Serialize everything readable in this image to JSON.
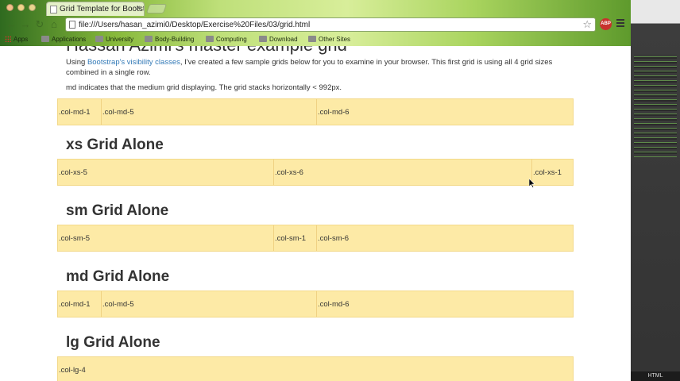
{
  "browser": {
    "tab_title": "Grid Template for Bootstrap",
    "tab_close": "×",
    "url": "file:///Users/hasan_azimi0/Desktop/Exercise%20Files/03/grid.html",
    "back": "←",
    "forward": "→",
    "reload": "↻",
    "home": "⌂",
    "star": "☆",
    "abp_label": "ABP",
    "bookmarks": [
      "Apps",
      "Applications",
      "University",
      "Body-Building",
      "Computing",
      "Download",
      "Other Sites"
    ]
  },
  "page": {
    "cut_heading": "Hassan Azimi's master example grid",
    "intro_before": "Using ",
    "intro_link": "Bootstrap's visibility classes",
    "intro_after": ", I've created a few sample grids below for you to examine in your browser. This first grid is using all 4 grid sizes combined in a single row.",
    "md_note": "md indicates that the medium grid displaying. The grid stacks horizontally < 992px.",
    "first_row": [
      ".col-md-1",
      ".col-md-5",
      ".col-md-6"
    ],
    "sections": [
      {
        "heading": "xs Grid Alone",
        "cells": [
          ".col-xs-5",
          ".col-xs-6",
          ".col-xs-1"
        ]
      },
      {
        "heading": "sm Grid Alone",
        "cells": [
          ".col-sm-5",
          ".col-sm-1",
          ".col-sm-6"
        ]
      },
      {
        "heading": "md Grid Alone",
        "cells": [
          ".col-md-1",
          ".col-md-5",
          ".col-md-6"
        ]
      },
      {
        "heading": "lg Grid Alone",
        "cells": [
          ".col-lg-4"
        ]
      }
    ]
  },
  "side_panel": {
    "footer_label": "HTML"
  },
  "colors": {
    "grid_cell": "#fdeaa6",
    "link": "#337ab7",
    "chrome_green": "#a9d45e"
  },
  "icons": [
    "back-icon",
    "forward-icon",
    "reload-icon",
    "home-icon",
    "star-icon",
    "menu-icon",
    "folder-icon",
    "apps-icon",
    "cursor-icon"
  ]
}
